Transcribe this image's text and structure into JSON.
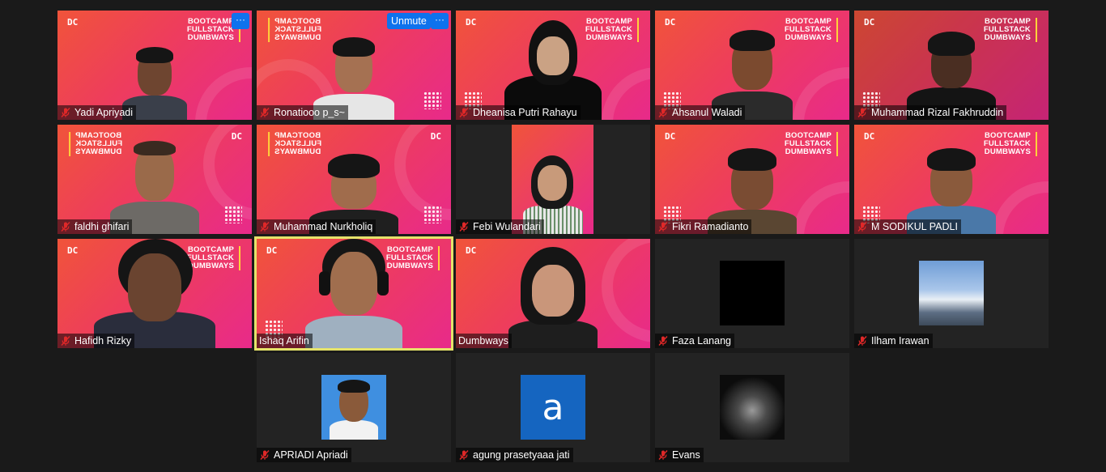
{
  "meeting": {
    "banner_text": "BOOTCAMP\nFULLSTACK\nDUMBWAYS",
    "logo_text": "DC",
    "controls": {
      "more_symbol": "···",
      "unmute_label": "Unmute"
    }
  },
  "participants": [
    {
      "name": "Yadi Apriyadi",
      "muted": true,
      "video": true
    },
    {
      "name": "Ronatiooo p_s~",
      "muted": true,
      "video": true
    },
    {
      "name": "Dheanisa Putri Rahayu",
      "muted": true,
      "video": true
    },
    {
      "name": "Ahsanul Waladi",
      "muted": true,
      "video": true
    },
    {
      "name": "Muhammad Rizal Fakhruddin",
      "muted": true,
      "video": true
    },
    {
      "name": "faldhi ghifari",
      "muted": true,
      "video": true
    },
    {
      "name": "Muhammad Nurkholiq",
      "muted": true,
      "video": true
    },
    {
      "name": "Febi Wulandari",
      "muted": true,
      "video": true
    },
    {
      "name": "Fikri Ramadianto",
      "muted": true,
      "video": true
    },
    {
      "name": "M SODIKUL PADLI",
      "muted": true,
      "video": true
    },
    {
      "name": "Hafidh Rizky",
      "muted": true,
      "video": true
    },
    {
      "name": "Ishaq Arifin",
      "muted": false,
      "video": true,
      "active_speaker": true
    },
    {
      "name": "Dumbways",
      "muted": false,
      "video": true
    },
    {
      "name": "Faza Lanang",
      "muted": true,
      "video": false
    },
    {
      "name": "Ilham Irawan",
      "muted": true,
      "video": false
    },
    {
      "name": "APRIADI Apriadi",
      "muted": true,
      "video": false
    },
    {
      "name": "agung prasetyaaa jati",
      "muted": true,
      "video": false,
      "avatar_letter": "a"
    },
    {
      "name": "Evans",
      "muted": true,
      "video": false
    }
  ]
}
